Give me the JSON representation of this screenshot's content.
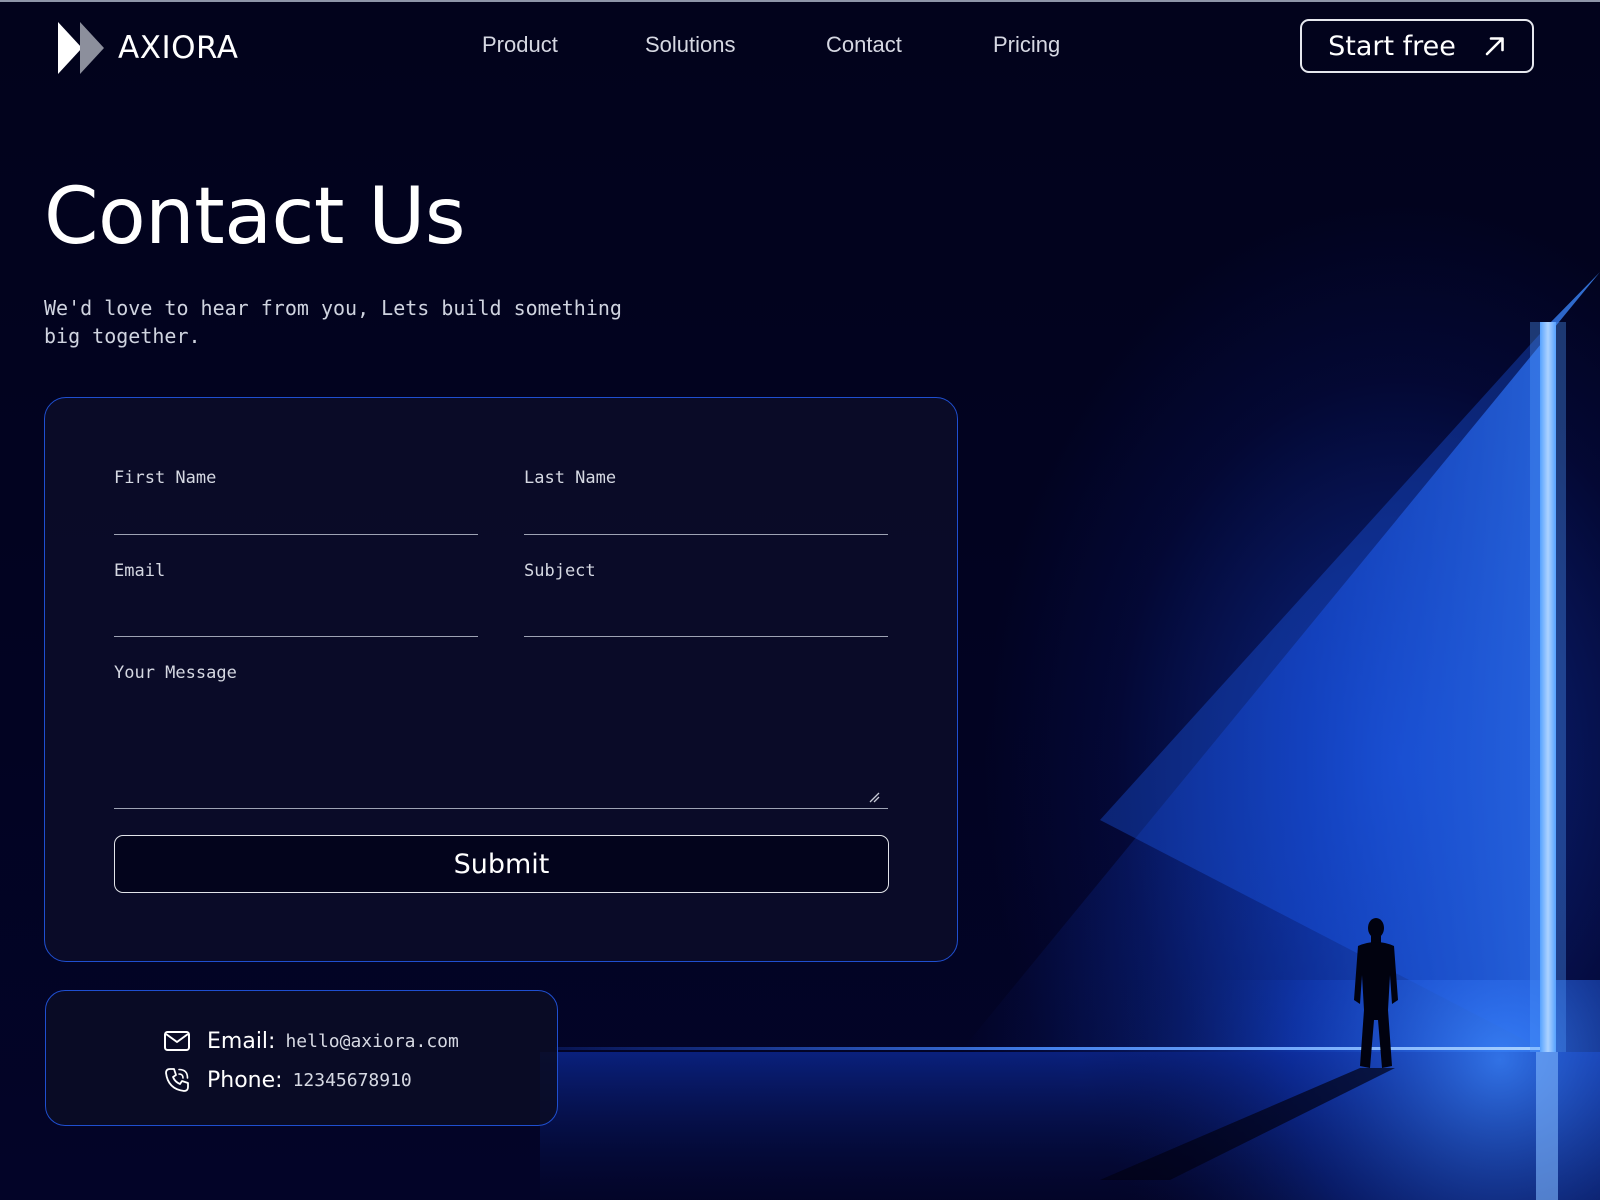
{
  "brand": {
    "name": "AXIORA"
  },
  "nav": {
    "items": [
      {
        "label": "Product"
      },
      {
        "label": "Solutions"
      },
      {
        "label": "Contact"
      },
      {
        "label": "Pricing"
      }
    ],
    "cta_label": "Start free"
  },
  "hero": {
    "title": "Contact Us",
    "subtitle": "We'd love to hear from you, Lets build something big together."
  },
  "form": {
    "fields": {
      "first_name": {
        "label": "First Name",
        "value": ""
      },
      "last_name": {
        "label": "Last Name",
        "value": ""
      },
      "email": {
        "label": "Email",
        "value": ""
      },
      "subject": {
        "label": "Subject",
        "value": ""
      },
      "message": {
        "label": "Your Message",
        "value": ""
      }
    },
    "submit_label": "Submit"
  },
  "contact_info": {
    "email_key": "Email:",
    "email_value": "hello@axiora.com",
    "phone_key": "Phone:",
    "phone_value": "12345678910"
  },
  "icons": {
    "logo": "double-chevron-logo-icon",
    "cta": "arrow-up-right-icon",
    "email": "envelope-icon",
    "phone": "phone-ringing-icon",
    "resize": "resize-grip-icon"
  },
  "colors": {
    "background": "#02031a",
    "accent_blue": "#1f4fd0",
    "light_beam": "#3a8cff",
    "text_primary": "#ffffff",
    "text_secondary": "#d5d8e2"
  }
}
